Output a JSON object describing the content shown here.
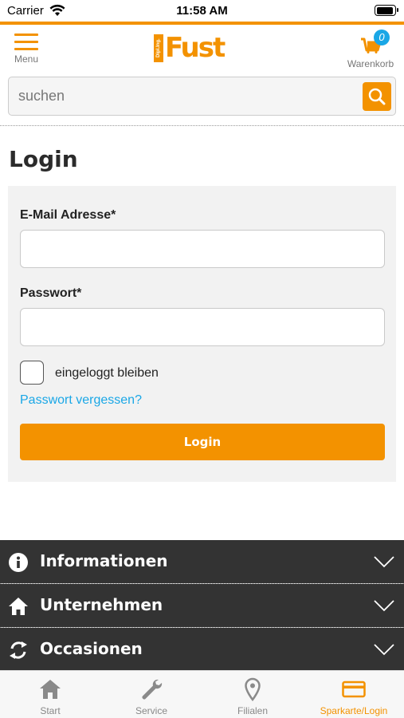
{
  "status_bar": {
    "carrier": "Carrier",
    "time": "11:58 AM"
  },
  "header": {
    "menu_label": "Menu",
    "logo_text": "Fust",
    "logo_tag": "Dipl.Ing.",
    "cart_label": "Warenkorb",
    "cart_count": "0"
  },
  "search": {
    "placeholder": "suchen"
  },
  "login": {
    "title": "Login",
    "email_label": "E-Mail Adresse*",
    "email_value": "",
    "password_label": "Passwort*",
    "password_value": "",
    "remember_label": "eingeloggt bleiben",
    "remember_checked": false,
    "forgot_link": "Passwort vergessen?",
    "submit_label": "Login"
  },
  "accordions": [
    {
      "label": "Informationen",
      "icon": "info-icon"
    },
    {
      "label": "Unternehmen",
      "icon": "home-icon"
    },
    {
      "label": "Occasionen",
      "icon": "refresh-icon"
    }
  ],
  "tabbar": [
    {
      "label": "Start",
      "icon": "home-icon",
      "active": false
    },
    {
      "label": "Service",
      "icon": "wrench-icon",
      "active": false
    },
    {
      "label": "Filialen",
      "icon": "map-pin-icon",
      "active": false
    },
    {
      "label": "Sparkarte/Login",
      "icon": "card-icon",
      "active": true
    }
  ],
  "colors": {
    "accent": "#f39200",
    "link": "#1aa7e6",
    "dark": "#333333"
  }
}
